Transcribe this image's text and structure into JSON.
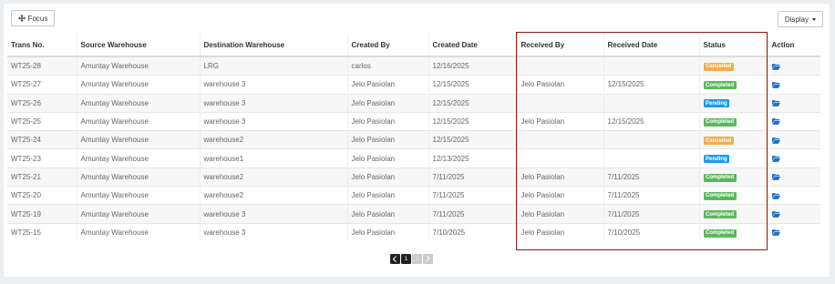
{
  "toolbar": {
    "focus_label": "Focus",
    "display_label": "Display"
  },
  "table": {
    "columns": [
      "Trans No.",
      "Source Warehouse",
      "Destination Warehouse",
      "Created By",
      "Created Date",
      "Received By",
      "Received Date",
      "Status",
      "Action"
    ],
    "rows": [
      {
        "trans_no": "WT25-28",
        "source": "Amuntay Warehouse",
        "destination": "LRG",
        "created_by": "carlos",
        "created_date": "12/16/2025",
        "received_by": "",
        "received_date": "",
        "status": "Cancelled"
      },
      {
        "trans_no": "WT25-27",
        "source": "Amuntay Warehouse",
        "destination": "warehouse 3",
        "created_by": "Jelo Pasiolan",
        "created_date": "12/15/2025",
        "received_by": "Jelo Pasiolan",
        "received_date": "12/15/2025",
        "status": "Completed"
      },
      {
        "trans_no": "WT25-26",
        "source": "Amuntay Warehouse",
        "destination": "warehouse 3",
        "created_by": "Jelo Pasiolan",
        "created_date": "12/15/2025",
        "received_by": "",
        "received_date": "",
        "status": "Pending"
      },
      {
        "trans_no": "WT25-25",
        "source": "Amuntay Warehouse",
        "destination": "warehouse 3",
        "created_by": "Jelo Pasiolan",
        "created_date": "12/15/2025",
        "received_by": "Jelo Pasiolan",
        "received_date": "12/15/2025",
        "status": "Completed"
      },
      {
        "trans_no": "WT25-24",
        "source": "Amuntay Warehouse",
        "destination": "warehouse2",
        "created_by": "Jelo Pasiolan",
        "created_date": "12/15/2025",
        "received_by": "",
        "received_date": "",
        "status": "Cancelled"
      },
      {
        "trans_no": "WT25-23",
        "source": "Amuntay Warehouse",
        "destination": "warehouse1",
        "created_by": "Jelo Pasiolan",
        "created_date": "12/13/2025",
        "received_by": "",
        "received_date": "",
        "status": "Pending"
      },
      {
        "trans_no": "WT25-21",
        "source": "Amuntay Warehouse",
        "destination": "warehouse2",
        "created_by": "Jelo Pasiolan",
        "created_date": "7/11/2025",
        "received_by": "Jelo Pasiolan",
        "received_date": "7/11/2025",
        "status": "Completed"
      },
      {
        "trans_no": "WT25-20",
        "source": "Amuntay Warehouse",
        "destination": "warehouse2",
        "created_by": "Jelo Pasiolan",
        "created_date": "7/11/2025",
        "received_by": "Jelo Pasiolan",
        "received_date": "7/11/2025",
        "status": "Completed"
      },
      {
        "trans_no": "WT25-19",
        "source": "Amuntay Warehouse",
        "destination": "warehouse 3",
        "created_by": "Jelo Pasiolan",
        "created_date": "7/11/2025",
        "received_by": "Jelo Pasiolan",
        "received_date": "7/11/2025",
        "status": "Completed"
      },
      {
        "trans_no": "WT25-15",
        "source": "Amuntay Warehouse",
        "destination": "warehouse 3",
        "created_by": "Jelo Pasiolan",
        "created_date": "7/10/2025",
        "received_by": "Jelo Pasiolan",
        "received_date": "7/10/2025",
        "status": "Completed"
      }
    ]
  },
  "status_colors": {
    "Cancelled": "#f0ad4e",
    "Completed": "#5cb85c",
    "Pending": "#1e9be8"
  },
  "action_icon": "folder-open-icon",
  "action_icon_color": "#1f6fc5",
  "pagination": {
    "pages": [
      "1",
      "2"
    ],
    "current": "1"
  }
}
